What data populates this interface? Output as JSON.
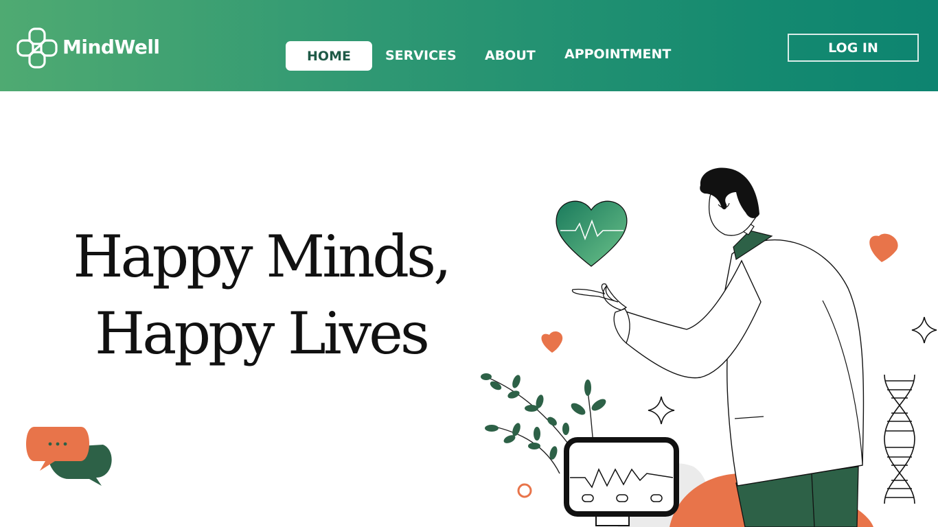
{
  "brand": {
    "name": "MindWell",
    "logo_icon": "clover-cross-logo-icon"
  },
  "nav": {
    "items": [
      {
        "label": "HOME",
        "active": true
      },
      {
        "label": "SERVICES",
        "active": false
      },
      {
        "label": "ABOUT",
        "active": false
      },
      {
        "label": "APPOINTMENT",
        "active": false
      }
    ],
    "login_label": "LOG IN"
  },
  "hero": {
    "line1": "Happy Minds,",
    "line2": "Happy Lives"
  },
  "colors": {
    "header_gradient_start": "#4faa72",
    "header_gradient_end": "#0d8470",
    "accent_orange": "#e8744a",
    "dark_green": "#2d6147",
    "text_dark": "#111111"
  },
  "icons": [
    "chat-bubbles-icon",
    "heart-monitor-icon",
    "heart-icon",
    "sparkle-icon",
    "dna-icon",
    "plant-icon",
    "ecg-monitor-icon"
  ]
}
